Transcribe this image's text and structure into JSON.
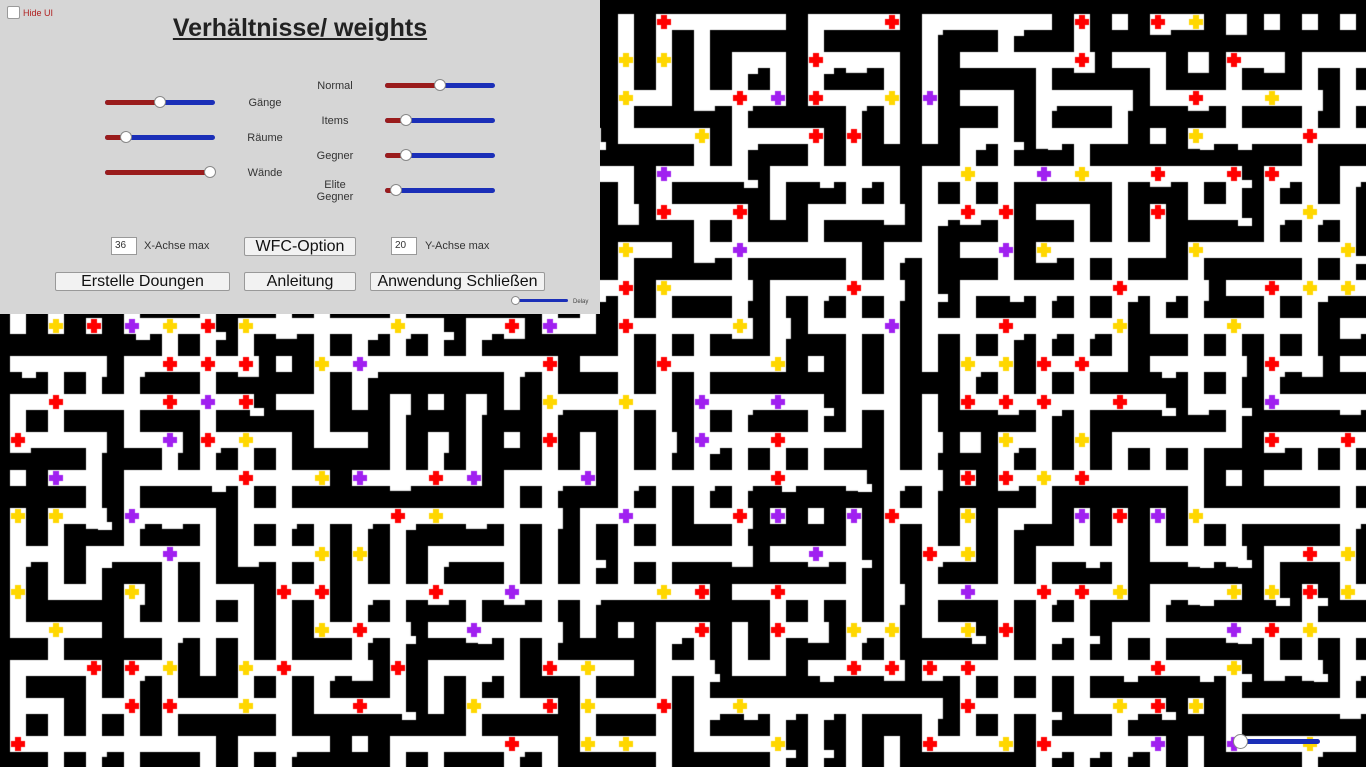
{
  "hide_ui": {
    "label": "Hide UI",
    "checked": false
  },
  "title": "Verhältnisse/ weights",
  "weights_left": [
    {
      "label": "Gänge",
      "value": 0.5
    },
    {
      "label": "Räume",
      "value": 0.19
    },
    {
      "label": "Wände",
      "value": 0.95
    }
  ],
  "weights_right": [
    {
      "label": "Normal",
      "value": 0.5
    },
    {
      "label": "Items",
      "value": 0.19
    },
    {
      "label": "Gegner",
      "value": 0.19
    },
    {
      "label": "Elite Gegner",
      "value": 0.1
    }
  ],
  "x_axis": {
    "value": "36",
    "label": "X-Achse max"
  },
  "y_axis": {
    "value": "20",
    "label": "Y-Achse max"
  },
  "buttons": {
    "wfc": "WFC-Option",
    "create": "Erstelle Doungen",
    "guide": "Anleitung",
    "close": "Anwendung Schließen"
  },
  "delay": {
    "label": "Delay",
    "value": 0.0
  },
  "corner_slider": {
    "value": 0.0
  },
  "colors": {
    "wall": "#000000",
    "floor": "#ffffff",
    "enemy": "#ff0000",
    "item": "#ffd700",
    "elite": "#a020f0",
    "panel": "#d6d6d6",
    "slider_red": "#9a1c1c",
    "slider_blue": "#1b2fb8"
  },
  "markers": {
    "enemy": [
      [
        664,
        22
      ],
      [
        892,
        22
      ],
      [
        1082,
        22
      ],
      [
        1158,
        22
      ],
      [
        816,
        60
      ],
      [
        1082,
        60
      ],
      [
        1234,
        60
      ],
      [
        740,
        98
      ],
      [
        816,
        98
      ],
      [
        1196,
        98
      ],
      [
        816,
        136
      ],
      [
        854,
        136
      ],
      [
        1310,
        136
      ],
      [
        1158,
        174
      ],
      [
        1234,
        174
      ],
      [
        1272,
        174
      ],
      [
        664,
        212
      ],
      [
        740,
        212
      ],
      [
        968,
        212
      ],
      [
        1006,
        212
      ],
      [
        1158,
        212
      ],
      [
        626,
        288
      ],
      [
        854,
        288
      ],
      [
        1120,
        288
      ],
      [
        1272,
        288
      ],
      [
        94,
        326
      ],
      [
        208,
        326
      ],
      [
        512,
        326
      ],
      [
        626,
        326
      ],
      [
        1006,
        326
      ],
      [
        170,
        364
      ],
      [
        208,
        364
      ],
      [
        246,
        364
      ],
      [
        550,
        364
      ],
      [
        664,
        364
      ],
      [
        1044,
        364
      ],
      [
        1082,
        364
      ],
      [
        1272,
        364
      ],
      [
        56,
        402
      ],
      [
        170,
        402
      ],
      [
        246,
        402
      ],
      [
        968,
        402
      ],
      [
        1006,
        402
      ],
      [
        1044,
        402
      ],
      [
        1120,
        402
      ],
      [
        18,
        440
      ],
      [
        208,
        440
      ],
      [
        550,
        440
      ],
      [
        778,
        440
      ],
      [
        1272,
        440
      ],
      [
        1348,
        440
      ],
      [
        246,
        478
      ],
      [
        436,
        478
      ],
      [
        778,
        478
      ],
      [
        968,
        478
      ],
      [
        1006,
        478
      ],
      [
        1082,
        478
      ],
      [
        398,
        516
      ],
      [
        740,
        516
      ],
      [
        892,
        516
      ],
      [
        1120,
        516
      ],
      [
        930,
        554
      ],
      [
        1310,
        554
      ],
      [
        284,
        592
      ],
      [
        322,
        592
      ],
      [
        436,
        592
      ],
      [
        702,
        592
      ],
      [
        778,
        592
      ],
      [
        1044,
        592
      ],
      [
        1082,
        592
      ],
      [
        1310,
        592
      ],
      [
        360,
        630
      ],
      [
        702,
        630
      ],
      [
        778,
        630
      ],
      [
        1006,
        630
      ],
      [
        1272,
        630
      ],
      [
        94,
        668
      ],
      [
        132,
        668
      ],
      [
        284,
        668
      ],
      [
        398,
        668
      ],
      [
        550,
        668
      ],
      [
        854,
        668
      ],
      [
        892,
        668
      ],
      [
        930,
        668
      ],
      [
        968,
        668
      ],
      [
        1158,
        668
      ],
      [
        132,
        706
      ],
      [
        170,
        706
      ],
      [
        360,
        706
      ],
      [
        550,
        706
      ],
      [
        664,
        706
      ],
      [
        968,
        706
      ],
      [
        1158,
        706
      ],
      [
        18,
        744
      ],
      [
        512,
        744
      ],
      [
        930,
        744
      ],
      [
        1044,
        744
      ]
    ],
    "item": [
      [
        1196,
        22
      ],
      [
        626,
        60
      ],
      [
        664,
        60
      ],
      [
        626,
        98
      ],
      [
        892,
        98
      ],
      [
        1272,
        98
      ],
      [
        702,
        136
      ],
      [
        1196,
        136
      ],
      [
        968,
        174
      ],
      [
        1082,
        174
      ],
      [
        1310,
        212
      ],
      [
        626,
        250
      ],
      [
        1044,
        250
      ],
      [
        1196,
        250
      ],
      [
        1348,
        250
      ],
      [
        664,
        288
      ],
      [
        1310,
        288
      ],
      [
        1348,
        288
      ],
      [
        56,
        326
      ],
      [
        170,
        326
      ],
      [
        246,
        326
      ],
      [
        398,
        326
      ],
      [
        740,
        326
      ],
      [
        1120,
        326
      ],
      [
        1234,
        326
      ],
      [
        322,
        364
      ],
      [
        778,
        364
      ],
      [
        968,
        364
      ],
      [
        1006,
        364
      ],
      [
        550,
        402
      ],
      [
        626,
        402
      ],
      [
        246,
        440
      ],
      [
        1006,
        440
      ],
      [
        1082,
        440
      ],
      [
        322,
        478
      ],
      [
        1044,
        478
      ],
      [
        18,
        516
      ],
      [
        56,
        516
      ],
      [
        436,
        516
      ],
      [
        968,
        516
      ],
      [
        1196,
        516
      ],
      [
        322,
        554
      ],
      [
        360,
        554
      ],
      [
        968,
        554
      ],
      [
        1348,
        554
      ],
      [
        18,
        592
      ],
      [
        132,
        592
      ],
      [
        664,
        592
      ],
      [
        1120,
        592
      ],
      [
        1234,
        592
      ],
      [
        1272,
        592
      ],
      [
        1348,
        592
      ],
      [
        56,
        630
      ],
      [
        322,
        630
      ],
      [
        854,
        630
      ],
      [
        892,
        630
      ],
      [
        968,
        630
      ],
      [
        1310,
        630
      ],
      [
        170,
        668
      ],
      [
        246,
        668
      ],
      [
        588,
        668
      ],
      [
        1234,
        668
      ],
      [
        246,
        706
      ],
      [
        474,
        706
      ],
      [
        588,
        706
      ],
      [
        740,
        706
      ],
      [
        1120,
        706
      ],
      [
        1196,
        706
      ],
      [
        588,
        744
      ],
      [
        626,
        744
      ],
      [
        778,
        744
      ],
      [
        1006,
        744
      ],
      [
        1310,
        744
      ]
    ],
    "elite": [
      [
        778,
        98
      ],
      [
        930,
        98
      ],
      [
        664,
        174
      ],
      [
        1044,
        174
      ],
      [
        740,
        250
      ],
      [
        1006,
        250
      ],
      [
        132,
        326
      ],
      [
        550,
        326
      ],
      [
        892,
        326
      ],
      [
        360,
        364
      ],
      [
        208,
        402
      ],
      [
        702,
        402
      ],
      [
        778,
        402
      ],
      [
        1272,
        402
      ],
      [
        170,
        440
      ],
      [
        702,
        440
      ],
      [
        56,
        478
      ],
      [
        360,
        478
      ],
      [
        474,
        478
      ],
      [
        588,
        478
      ],
      [
        132,
        516
      ],
      [
        626,
        516
      ],
      [
        778,
        516
      ],
      [
        854,
        516
      ],
      [
        1082,
        516
      ],
      [
        1158,
        516
      ],
      [
        170,
        554
      ],
      [
        816,
        554
      ],
      [
        512,
        592
      ],
      [
        968,
        592
      ],
      [
        474,
        630
      ],
      [
        1234,
        630
      ],
      [
        1158,
        744
      ],
      [
        1234,
        744
      ]
    ]
  }
}
